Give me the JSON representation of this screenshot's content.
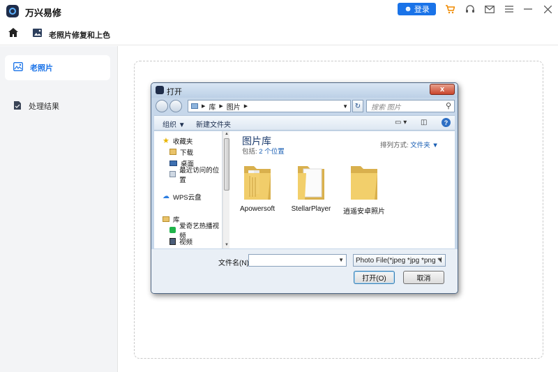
{
  "app": {
    "title": "万兴易修",
    "login_label": "登录"
  },
  "nav": {
    "title": "老照片修复和上色"
  },
  "sidebar": {
    "items": [
      {
        "label": "老照片",
        "active": true
      },
      {
        "label": "处理结果",
        "active": false
      }
    ]
  },
  "dialog": {
    "title": "打开",
    "close_label": "x",
    "breadcrumb": [
      "库",
      "图片"
    ],
    "search_placeholder": "搜索 图片",
    "toolbar": {
      "organize_label": "组织 ▼",
      "new_folder_label": "新建文件夹"
    },
    "nav_items": [
      {
        "label": "收藏夹",
        "icon": "star-icon",
        "sub": false
      },
      {
        "label": "下载",
        "icon": "download-folder-icon",
        "sub": true
      },
      {
        "label": "桌面",
        "icon": "desktop-icon",
        "sub": true
      },
      {
        "label": "最近访问的位置",
        "icon": "recent-places-icon",
        "sub": true
      },
      {
        "label": "WPS云盘",
        "icon": "cloud-icon",
        "sub": false
      },
      {
        "label": "库",
        "icon": "library-icon",
        "sub": false
      },
      {
        "label": "爱奇艺热播视频",
        "icon": "iqiyi-icon",
        "sub": true
      },
      {
        "label": "视频",
        "icon": "video-library-icon",
        "sub": true
      }
    ],
    "library_title": "图片库",
    "library_sub_prefix": "包括:",
    "library_sub_link": "2 个位置",
    "arrange_label": "排列方式:",
    "arrange_value": "文件夹 ▼",
    "folders": [
      {
        "label": "Apowersoft"
      },
      {
        "label": "StellarPlayer"
      },
      {
        "label": "逍遥安卓照片"
      }
    ],
    "filename_label": "文件名(N):",
    "filename_value": "",
    "filetype_value": "Photo File(*jpeg *jpg *png *l",
    "open_label": "打开(O)",
    "cancel_label": "取消"
  },
  "colors": {
    "accent": "#1a73e8",
    "sidebar_bg": "#f3f4f6",
    "dialog_frame": "#c6d7ea"
  }
}
